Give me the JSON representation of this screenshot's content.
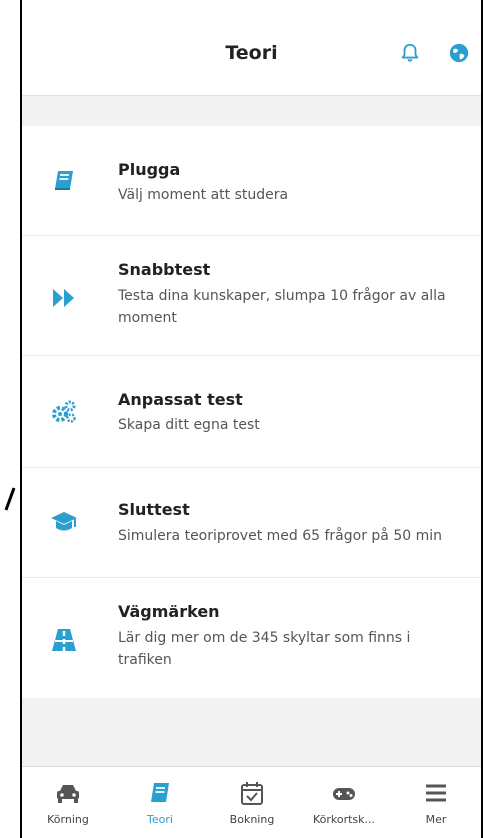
{
  "header": {
    "title": "Teori",
    "bell_icon": "bell-icon",
    "globe_icon": "globe-icon"
  },
  "accent_color": "#2a9fd0",
  "items": [
    {
      "title": "Plugga",
      "desc": "Välj moment att studera",
      "icon": "book-icon"
    },
    {
      "title": "Snabbtest",
      "desc": "Testa dina kunskaper, slumpa 10 frågor av alla moment",
      "icon": "fast-forward-icon"
    },
    {
      "title": "Anpassat test",
      "desc": "Skapa ditt egna test",
      "icon": "gears-icon"
    },
    {
      "title": "Sluttest",
      "desc": "Simulera teoriprovet med 65 frågor på 50 min",
      "icon": "graduation-cap-icon"
    },
    {
      "title": "Vägmärken",
      "desc": "Lär dig mer om de 345 skyltar som finns i trafiken",
      "icon": "road-icon"
    }
  ],
  "tabs": [
    {
      "label": "Körning",
      "icon": "car-icon"
    },
    {
      "label": "Teori",
      "icon": "book-icon",
      "active": true
    },
    {
      "label": "Bokning",
      "icon": "calendar-check-icon"
    },
    {
      "label": "Körkortsk...",
      "icon": "gamepad-icon"
    },
    {
      "label": "Mer",
      "icon": "menu-icon"
    }
  ]
}
